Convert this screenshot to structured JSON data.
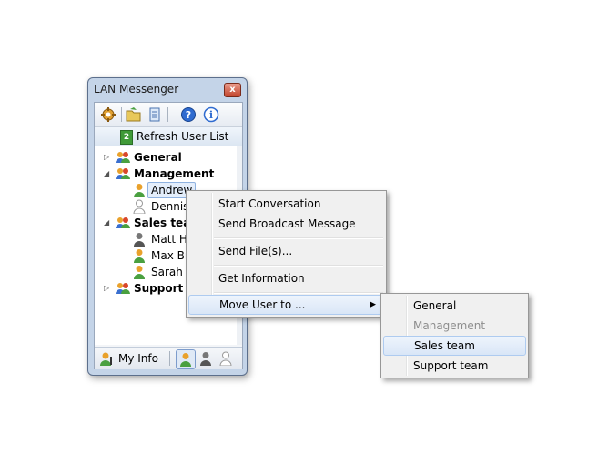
{
  "window": {
    "title": "LAN Messenger",
    "close_glyph": "x"
  },
  "toolbar": {
    "icons": [
      "settings-icon",
      "folder-open-icon",
      "history-icon",
      "help-icon",
      "info-icon"
    ]
  },
  "refresh": {
    "label": "Refresh User List",
    "icon_glyph": "2"
  },
  "tree": {
    "groups": [
      {
        "name": "General",
        "expanded": false
      },
      {
        "name": "Management",
        "expanded": true,
        "users": [
          "Andrew",
          "Dennis"
        ]
      },
      {
        "name": "Sales team",
        "display": "Sales tean",
        "expanded": true,
        "users": [
          "Matt H",
          "Max Br",
          "Sarah B"
        ]
      },
      {
        "name": "Support team",
        "display": "Support te",
        "expanded": false
      }
    ],
    "selected_user": "Andrew"
  },
  "bottombar": {
    "my_info_label": "My Info"
  },
  "context_menu": {
    "items": [
      "Start Conversation",
      "Send Broadcast Message",
      "Send File(s)...",
      "Get Information",
      "Move User to ..."
    ],
    "highlighted": "Move User to ..."
  },
  "submenu": {
    "items": [
      "General",
      "Management",
      "Sales team",
      "Support team"
    ],
    "disabled": "Management",
    "highlighted": "Sales team"
  },
  "colors": {
    "online": "#e9a12b",
    "busy": "#555555",
    "offline": "#bbbbbb",
    "group": "#3a6fcf",
    "selection": "#aecbf0"
  }
}
